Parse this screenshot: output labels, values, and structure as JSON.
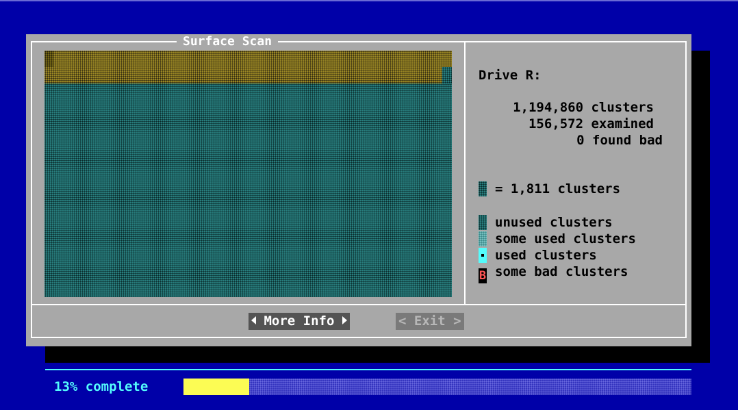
{
  "dialog": {
    "title": "Surface Scan"
  },
  "drive": {
    "label": "Drive R:",
    "total_clusters": "1,194,860 clusters",
    "examined": "156,572 examined",
    "found_bad": "0 found bad"
  },
  "legend": {
    "scale": "= 1,811 clusters",
    "unused": "unused clusters",
    "some_used": "some used clusters",
    "used": "used clusters",
    "some_bad": "some bad clusters",
    "bad_glyph": "B"
  },
  "buttons": {
    "more_info": "More Info",
    "exit": "< Exit >"
  },
  "status": {
    "text": "13% complete",
    "progress_fraction": 0.13
  },
  "colors": {
    "screen_bg": "#0000a8",
    "dialog_bg": "#a8a8a8",
    "unused": "#2e8e8e",
    "used": "#54fcfc",
    "scanned": "#b09a28",
    "progress": "#fcfc54",
    "status_text": "#54fcfc",
    "bad": "#ff5555"
  }
}
